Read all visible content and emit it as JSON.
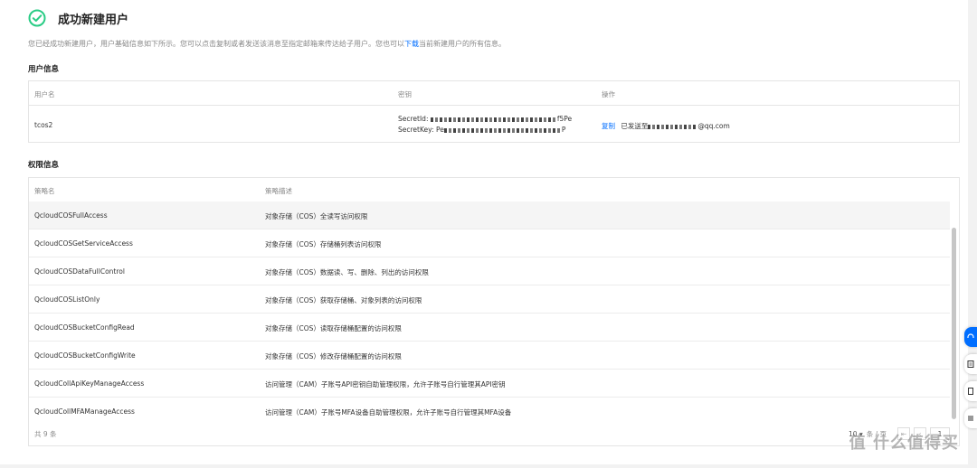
{
  "header": {
    "title": "成功新建用户",
    "icon": "check-circle-icon",
    "accent": "#29cc85"
  },
  "description": {
    "before": "您已经成功新建用户，用户基础信息如下所示。您可以点击复制或者发送该消息至指定邮箱来传达给子用户。您也可以",
    "link": "下载",
    "after": "当前新建用户的所有信息。"
  },
  "user_section": {
    "title": "用户信息",
    "columns": [
      "用户名",
      "密钥",
      "操作"
    ],
    "row": {
      "username": "tcos2",
      "secret_id_label": "SecretId:",
      "secret_id_tail": "f5Pe",
      "secret_key_label": "SecretKey:",
      "secret_key_head": "Pe",
      "secret_key_tail": "P",
      "copy_label": "复制",
      "sent_prefix": "已发送至",
      "email_suffix": "@qq.com"
    }
  },
  "permission_section": {
    "title": "权限信息",
    "columns": [
      "策略名",
      "策略描述"
    ],
    "rows": [
      {
        "name": "QcloudCOSFullAccess",
        "desc": "对象存储（COS）全读写访问权限"
      },
      {
        "name": "QcloudCOSGetServiceAccess",
        "desc": "对象存储（COS）存储桶列表访问权限"
      },
      {
        "name": "QcloudCOSDataFullControl",
        "desc": "对象存储（COS）数据读、写、删除、列出的访问权限"
      },
      {
        "name": "QcloudCOSListOnly",
        "desc": "对象存储（COS）获取存储桶、对象列表的访问权限"
      },
      {
        "name": "QcloudCOSBucketConfigRead",
        "desc": "对象存储（COS）读取存储桶配置的访问权限"
      },
      {
        "name": "QcloudCOSBucketConfigWrite",
        "desc": "对象存储（COS）修改存储桶配置的访问权限"
      },
      {
        "name": "QcloudCollApiKeyManageAccess",
        "desc": "访问管理（CAM）子账号API密钥自助管理权限，允许子账号自行管理其API密钥"
      },
      {
        "name": "QcloudCollMFAManageAccess",
        "desc": "访问管理（CAM）子账号MFA设备自助管理权限，允许子账号自行管理其MFA设备"
      }
    ],
    "total": "共 9 条",
    "page_size": "10",
    "page_size_unit": "条 / 页",
    "current_page": "1"
  },
  "watermark": "值 什么值得买"
}
